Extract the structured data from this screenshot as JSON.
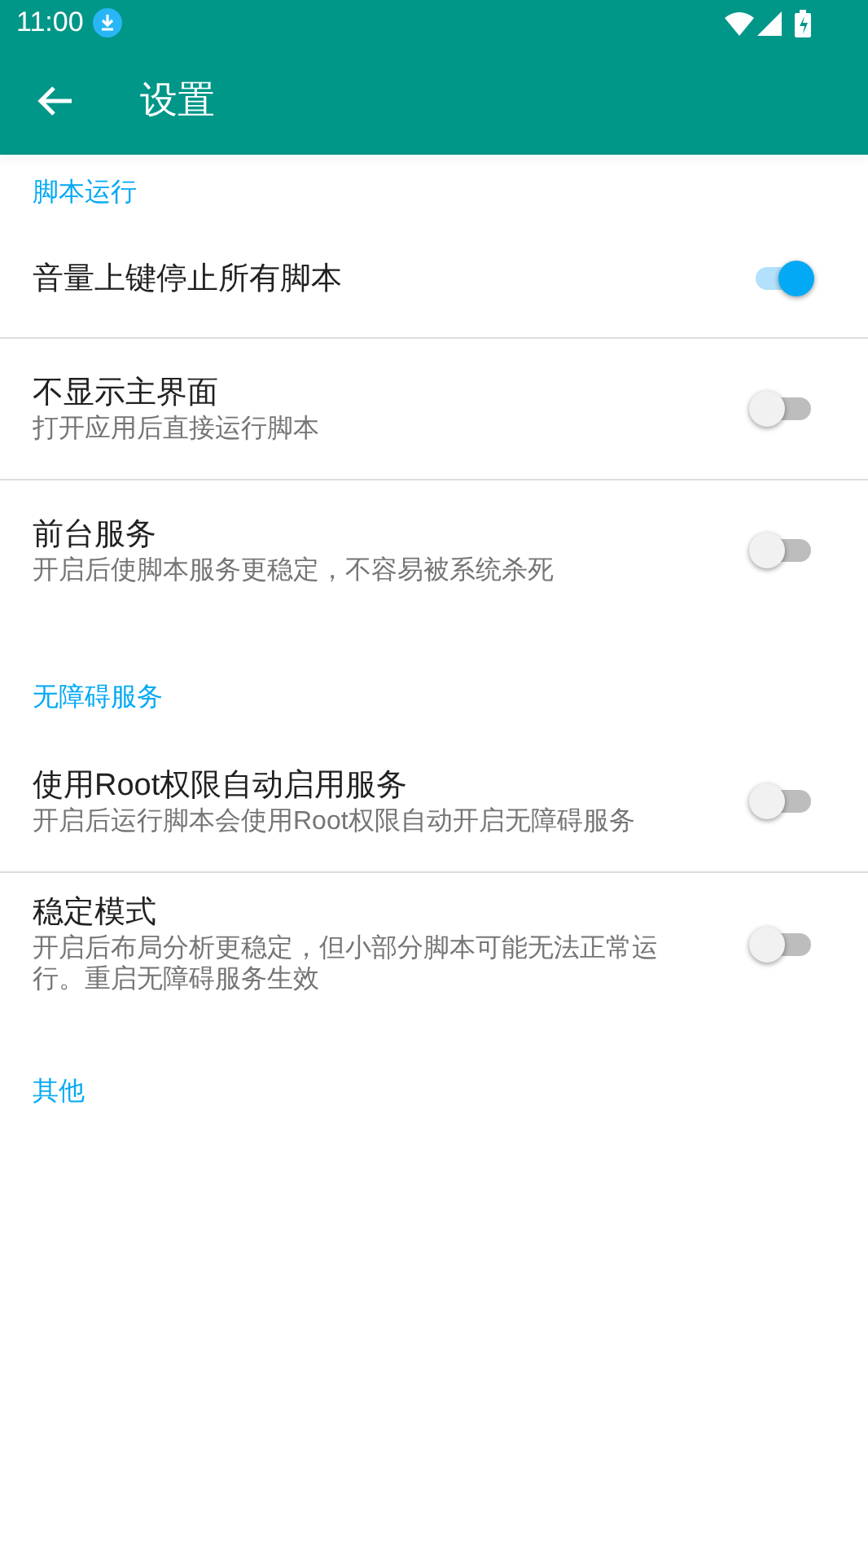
{
  "status_bar": {
    "time": "11:00"
  },
  "toolbar": {
    "title": "设置"
  },
  "sections": [
    {
      "header": "脚本运行",
      "items": [
        {
          "title": "音量上键停止所有脚本",
          "on": true
        },
        {
          "title": "不显示主界面",
          "subtitle": "打开应用后直接运行脚本",
          "on": false
        },
        {
          "title": "前台服务",
          "subtitle": "开启后使脚本服务更稳定，不容易被系统杀死",
          "on": false
        }
      ]
    },
    {
      "header": "无障碍服务",
      "items": [
        {
          "title": "使用Root权限自动启用服务",
          "subtitle": "开启后运行脚本会使用Root权限自动开启无障碍服务",
          "on": false
        },
        {
          "title": "稳定模式",
          "subtitle": "开启后布局分析更稳定，但小部分脚本可能无法正常运行。重启无障碍服务生效",
          "on": false
        }
      ]
    },
    {
      "header": "其他"
    }
  ]
}
